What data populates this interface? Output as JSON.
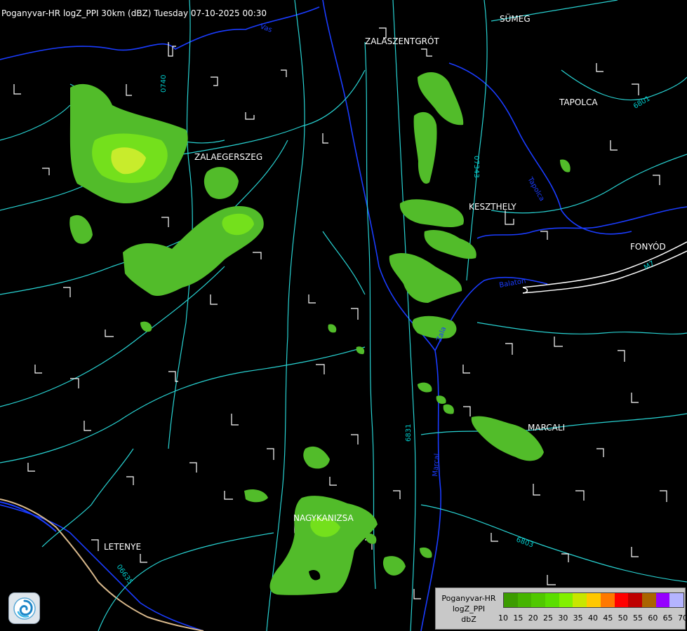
{
  "header": {
    "title": "Poganyvar-HR logZ_PPI 30km (dBZ) Tuesday 07-10-2025 00:30"
  },
  "places": {
    "sumeg": "SÜMEG",
    "zalaszentgrot": "ZALASZENTGRÓT",
    "tapolca": "TAPOLCA",
    "zalaegerszeg": "ZALAEGERSZEG",
    "keszthely": "KESZTHELY",
    "fonyod": "FONYÓD",
    "marcali": "MARCALI",
    "nagykanizsa": "NAGYKANIZSA",
    "letenye": "LETENYE"
  },
  "roads": {
    "r0740": "0740",
    "r07343": "07343",
    "r6801": "6801",
    "r6831": "6831",
    "r6803": "6803",
    "r06635": "06635",
    "r7": "M7"
  },
  "rivers": {
    "zala": "Zala",
    "vas": "Vas",
    "marcal": "Marcal",
    "tapolca": "Tapolca",
    "balaton": "Balaton"
  },
  "legend": {
    "line1": "Poganyvar-HR",
    "line2": "logZ_PPI",
    "line3": "dbZ",
    "ticks": [
      "10",
      "15",
      "20",
      "25",
      "30",
      "35",
      "40",
      "45",
      "50",
      "55",
      "60",
      "65",
      "70"
    ],
    "colors": [
      "#3c9c00",
      "#46b400",
      "#50c800",
      "#5ade00",
      "#82f000",
      "#c8e600",
      "#ffc800",
      "#ff7800",
      "#ff0000",
      "#be0000",
      "#aa6400",
      "#9600ff",
      "#b4b4ff"
    ]
  },
  "colors": {
    "echo_weak": "#52bc2a",
    "echo_mid": "#74e01c",
    "echo_strong": "#c8ec2c",
    "road_line": "#28d2d2",
    "border_line": "#ffffff",
    "river_line": "#1a3cff",
    "country_border": "#d9b98c"
  }
}
